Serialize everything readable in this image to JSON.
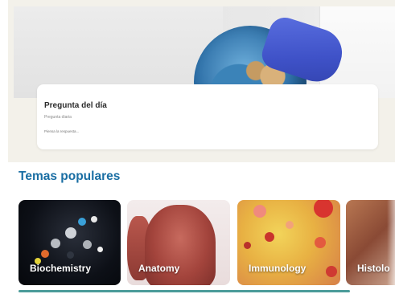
{
  "daily_question": {
    "title": "Pregunta del día",
    "subtitle": "Pregunta diaria",
    "hint": "Piensa la respuesta..."
  },
  "popular_topics": {
    "heading": "Temas populares",
    "items": [
      {
        "label": "Biochemistry"
      },
      {
        "label": "Anatomy"
      },
      {
        "label": "Immunology"
      },
      {
        "label": "Histolo"
      }
    ]
  },
  "colors": {
    "heading": "#1a6ea3",
    "page_background": "#f3f1ea",
    "accent_bar": "#4b9c9a"
  }
}
